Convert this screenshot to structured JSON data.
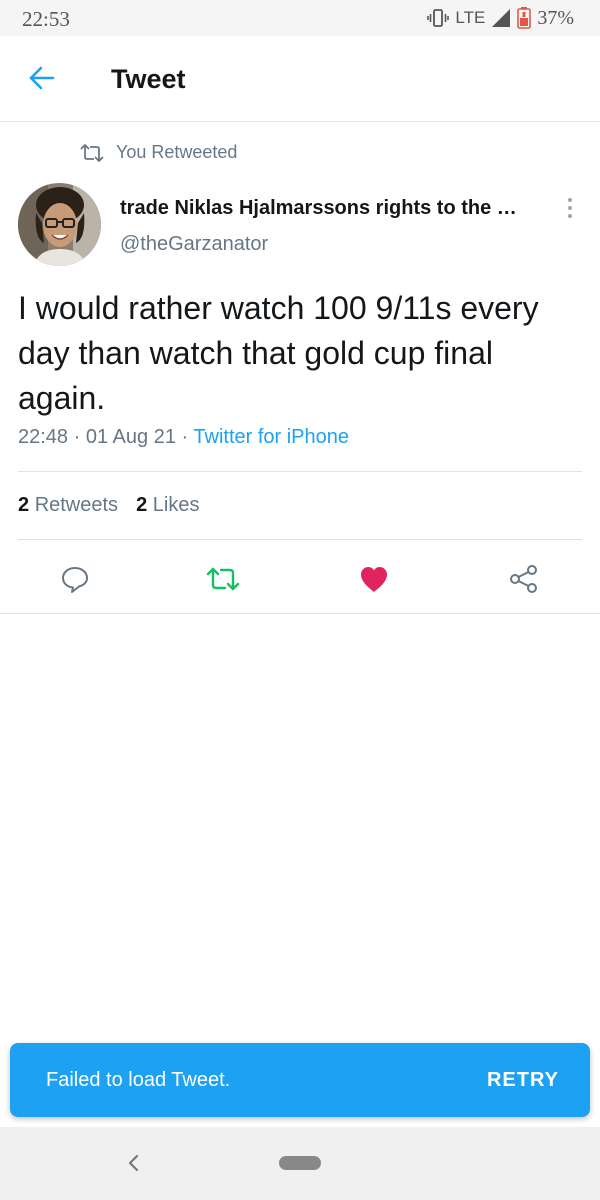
{
  "status_bar": {
    "time": "22:53",
    "network": "LTE",
    "battery": "37%"
  },
  "header": {
    "title": "Tweet"
  },
  "tweet": {
    "retweet_context": "You Retweeted",
    "display_name": "trade Niklas Hjalmarssons rights to the …",
    "handle": "@theGarzanator",
    "text": "I would rather watch 100 9/11s every day than watch that gold cup final again.",
    "time": "22:48",
    "date": "01 Aug 21",
    "source": "Twitter for iPhone",
    "separator": "·",
    "retweets_count": "2",
    "retweets_label": "Retweets",
    "likes_count": "2",
    "likes_label": "Likes"
  },
  "snackbar": {
    "message": "Failed to load Tweet.",
    "action": "RETRY"
  },
  "colors": {
    "accent": "#1da1f2",
    "retweet_green": "#17bf63",
    "like_red": "#e0245e",
    "muted": "#657786"
  },
  "icons": [
    "arrow-left-icon",
    "retweet-icon",
    "reply-icon",
    "heart-icon",
    "share-icon",
    "more-vertical-icon",
    "vibrate-icon",
    "signal-icon",
    "battery-icon",
    "nav-back-icon"
  ]
}
